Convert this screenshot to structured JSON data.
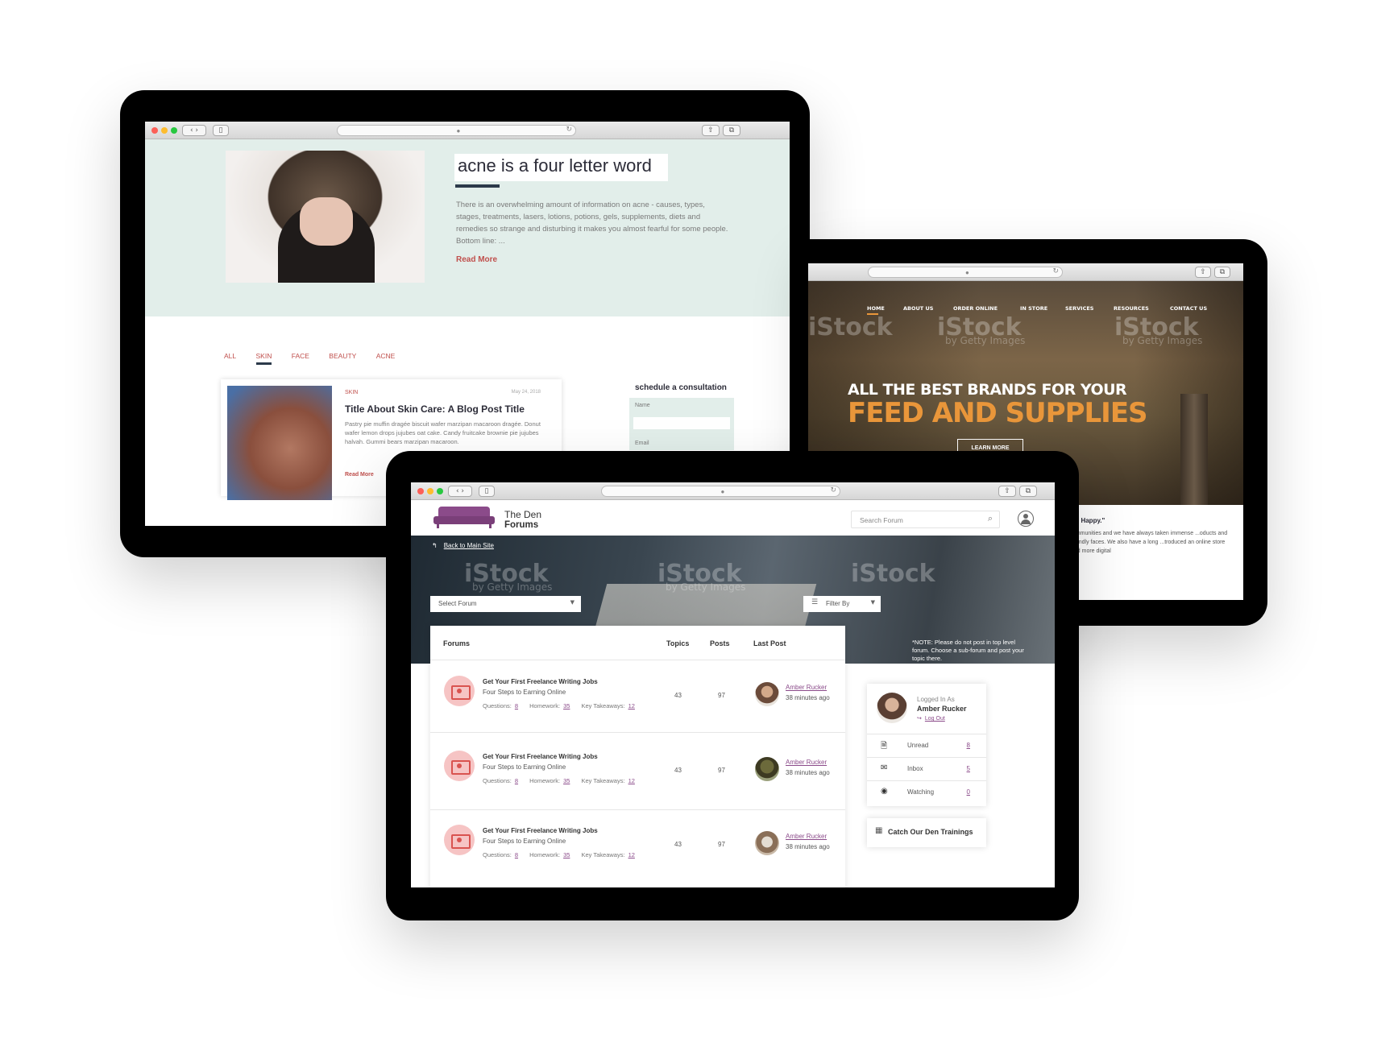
{
  "blog": {
    "title": "acne is a four letter word",
    "excerpt": "There is an overwhelming amount of information on acne - causes, types, stages, treatments, lasers, lotions, potions, gels, supplements, diets and remedies so strange and disturbing it makes you almost fearful for some people. Bottom line: ...",
    "read_more": "Read More",
    "categories": [
      "ALL",
      "SKIN",
      "FACE",
      "BEAUTY",
      "ACNE"
    ],
    "active_category": "SKIN",
    "card": {
      "tag": "SKIN",
      "date": "May 24, 2018",
      "title": "Title About Skin Care: A Blog Post Title",
      "text": "Pastry pie muffin dragée biscuit wafer marzipan macaroon dragée. Donut wafer lemon drops jujubes oat cake. Candy fruitcake brownie pie jujubes halvah. Gummi bears marzipan macaroon.",
      "read_more": "Read More"
    },
    "sidebar": {
      "heading": "schedule a consultation",
      "name_label": "Name",
      "email_label": "Email"
    }
  },
  "feed": {
    "nav": [
      "HOME",
      "ABOUT US",
      "ORDER ONLINE",
      "IN STORE",
      "SERVICES",
      "RESOURCES",
      "CONTACT US"
    ],
    "headline_1": "ALL THE BEST BRANDS FOR YOUR",
    "headline_2": "FEED AND SUPPLIES",
    "button": "LEARN MORE",
    "watermark": "iStock",
    "watermark_sub": "by Getty Images",
    "body_heading": "Be Happy.\"",
    "body_text": "...mmunities and we have always taken immense ...oducts and friendly faces. We also have a long ...troduced an online store and more digital",
    "accent": "#e9963a"
  },
  "forum": {
    "brand_line1": "The Den",
    "brand_line2": "Forums",
    "search_placeholder": "Search Forum",
    "back_link": "Back to Main Site",
    "select_forum": "Select Forum",
    "filter_by": "Filter By",
    "note": "*NOTE: Please do not post in top level forum. Choose a sub-forum and post your topic there.",
    "columns": {
      "forums": "Forums",
      "topics": "Topics",
      "posts": "Posts",
      "last_post": "Last Post"
    },
    "rows": [
      {
        "title": "Get Your First Freelance Writing Jobs",
        "subtitle": "Four Steps to Earning Online",
        "questions_label": "Questions:",
        "questions": "8",
        "homework_label": "Homework:",
        "homework": "35",
        "takeaways_label": "Key Takeaways:",
        "takeaways": "12",
        "topics": "43",
        "posts": "97",
        "user": "Amber Rucker",
        "time": "38 minutes ago"
      },
      {
        "title": "Get Your First Freelance Writing Jobs",
        "subtitle": "Four Steps to Earning Online",
        "questions_label": "Questions:",
        "questions": "8",
        "homework_label": "Homework:",
        "homework": "35",
        "takeaways_label": "Key Takeaways:",
        "takeaways": "12",
        "topics": "43",
        "posts": "97",
        "user": "Amber Rucker",
        "time": "38 minutes ago"
      },
      {
        "title": "Get Your First Freelance Writing Jobs",
        "subtitle": "Four Steps to Earning Online",
        "questions_label": "Questions:",
        "questions": "8",
        "homework_label": "Homework:",
        "homework": "35",
        "takeaways_label": "Key Takeaways:",
        "takeaways": "12",
        "topics": "43",
        "posts": "97",
        "user": "Amber Rucker",
        "time": "38 minutes ago"
      }
    ],
    "login": {
      "logged_in_as": "Logged In As",
      "name": "Amber Rucker",
      "logout": "Log Out",
      "stats": [
        {
          "label": "Unread",
          "value": "8",
          "icon": "document-icon"
        },
        {
          "label": "Inbox",
          "value": "5",
          "icon": "envelope-icon"
        },
        {
          "label": "Watching",
          "value": "0",
          "icon": "eye-icon"
        }
      ]
    },
    "trainings": "Catch Our Den Trainings",
    "accent": "#8b4b8a"
  }
}
